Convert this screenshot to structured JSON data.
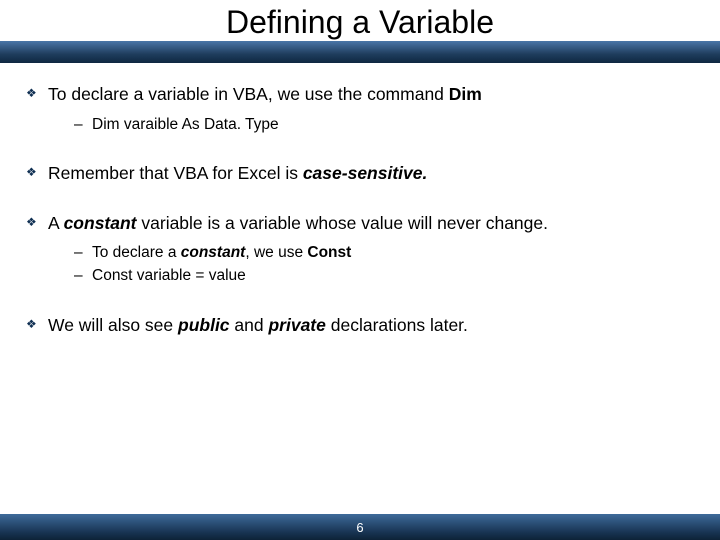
{
  "title": "Defining a Variable",
  "bullets": [
    {
      "segments": [
        {
          "t": "To declare a variable in VBA, we use the command "
        },
        {
          "t": "Dim",
          "class": "b"
        }
      ],
      "sub": [
        {
          "segments": [
            {
              "t": "Dim varaible As Data. Type"
            }
          ]
        }
      ]
    },
    {
      "segments": [
        {
          "t": "Remember that VBA for Excel is "
        },
        {
          "t": "case-sensitive.",
          "class": "ib"
        }
      ]
    },
    {
      "segments": [
        {
          "t": "A "
        },
        {
          "t": "constant",
          "class": "ib"
        },
        {
          "t": " variable is a variable whose value will never change."
        }
      ],
      "sub": [
        {
          "segments": [
            {
              "t": "To declare a "
            },
            {
              "t": "constant",
              "class": "ib"
            },
            {
              "t": ", we use "
            },
            {
              "t": "Const",
              "class": "b"
            }
          ]
        },
        {
          "segments": [
            {
              "t": "Const variable = value"
            }
          ]
        }
      ]
    },
    {
      "segments": [
        {
          "t": "We will also see "
        },
        {
          "t": "public",
          "class": "ib"
        },
        {
          "t": " and "
        },
        {
          "t": "private",
          "class": "ib"
        },
        {
          "t": " declarations later."
        }
      ]
    }
  ],
  "page_number": "6"
}
